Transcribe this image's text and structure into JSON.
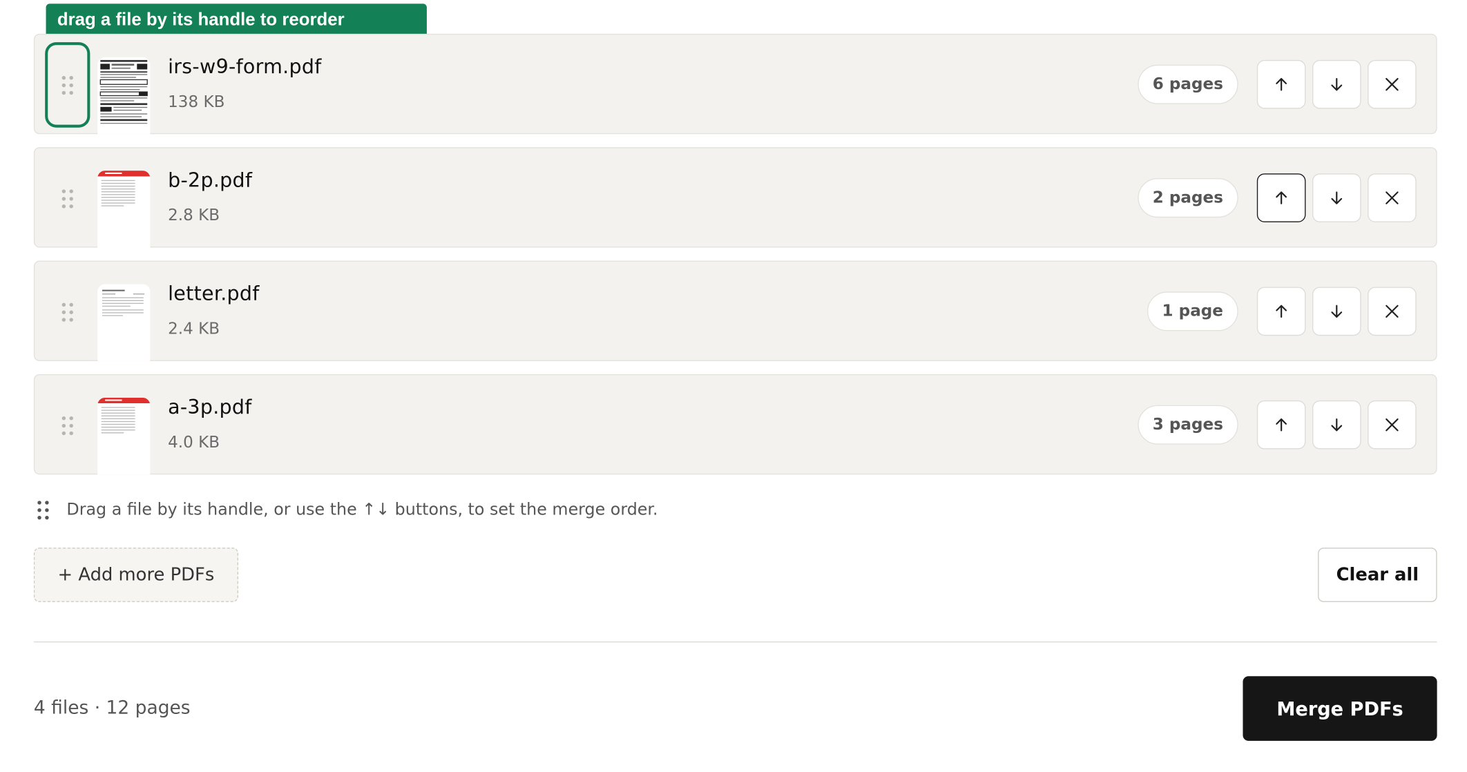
{
  "tooltip": {
    "text": "drag a file by its handle to reorder"
  },
  "files": [
    {
      "name": "irs-w9-form.pdf",
      "size": "138 KB",
      "pages": "6 pages",
      "thumbnail": "form-thumbnail"
    },
    {
      "name": "b-2p.pdf",
      "size": "2.8 KB",
      "pages": "2 pages",
      "thumbnail": "red-header-thumbnail"
    },
    {
      "name": "letter.pdf",
      "size": "2.4 KB",
      "pages": "1 page",
      "thumbnail": "letter-thumbnail"
    },
    {
      "name": "a-3p.pdf",
      "size": "4.0 KB",
      "pages": "3 pages",
      "thumbnail": "red-header-thumbnail"
    }
  ],
  "row_actions": {
    "move_up_icon": "arrow-up-icon",
    "move_down_icon": "arrow-down-icon",
    "remove_icon": "close-icon",
    "drag_handle_icon": "drag-handle-icon"
  },
  "hint": {
    "text": "Drag a file by its handle, or use the ↑↓ buttons, to set the merge order."
  },
  "actions": {
    "add_more_label": "+ Add more PDFs",
    "clear_all_label": "Clear all",
    "merge_label": "Merge PDFs"
  },
  "summary": {
    "text": "4 files · 12 pages"
  },
  "colors": {
    "accent": "#138056",
    "row_background": "#f3f2ef",
    "primary_button": "#161616",
    "thumbnail_header_red": "#e0302e"
  }
}
